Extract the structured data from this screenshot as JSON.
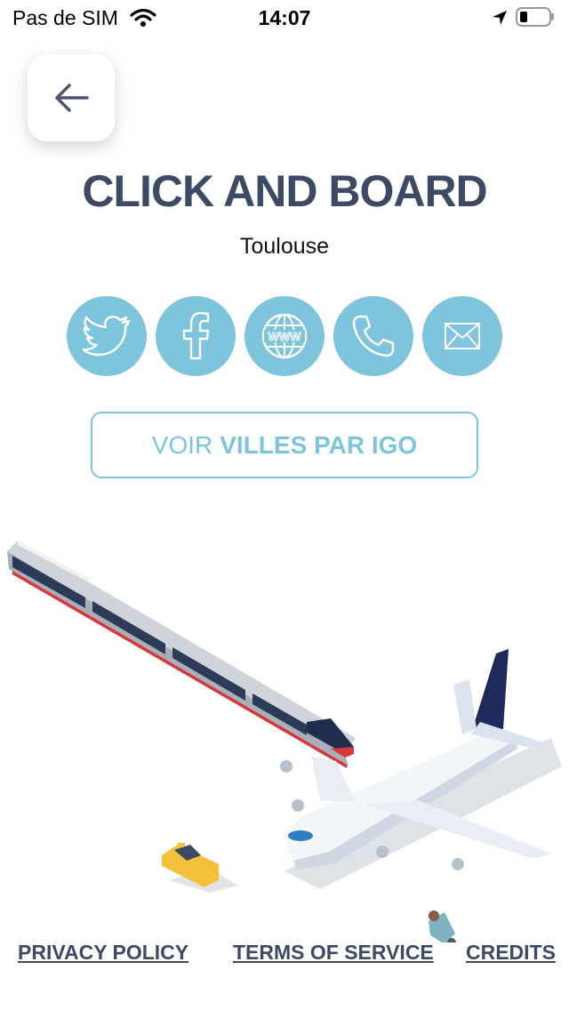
{
  "status_bar": {
    "carrier": "Pas de SIM",
    "time": "14:07"
  },
  "header": {
    "back_icon": "arrow-left-icon"
  },
  "business": {
    "name": "CLICK AND BOARD",
    "city": "Toulouse"
  },
  "social": [
    {
      "name": "twitter-icon"
    },
    {
      "name": "facebook-icon"
    },
    {
      "name": "website-icon"
    },
    {
      "name": "phone-icon"
    },
    {
      "name": "email-icon"
    }
  ],
  "voir_button": {
    "prefix": "VOIR",
    "emphasis": "VILLES PAR IGO"
  },
  "footer": {
    "privacy": "PRIVACY POLICY",
    "terms": "TERMS OF SERVICE",
    "credits": "CREDITS"
  },
  "colors": {
    "accent": "#7ec4dc",
    "title": "#3d4a63"
  }
}
